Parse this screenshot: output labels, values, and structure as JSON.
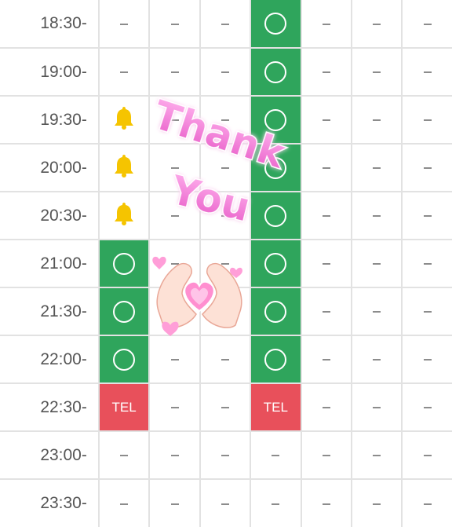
{
  "schedule": {
    "rows": [
      {
        "time": "18:30-",
        "cells": [
          "dash",
          "dash",
          "dash",
          "avail",
          "dash",
          "dash",
          "dash"
        ]
      },
      {
        "time": "19:00-",
        "cells": [
          "dash",
          "dash",
          "dash",
          "avail",
          "dash",
          "dash",
          "dash"
        ]
      },
      {
        "time": "19:30-",
        "cells": [
          "bell",
          "dash",
          "dash",
          "avail",
          "dash",
          "dash",
          "dash"
        ]
      },
      {
        "time": "20:00-",
        "cells": [
          "bell",
          "dash",
          "dash",
          "avail",
          "dash",
          "dash",
          "dash"
        ]
      },
      {
        "time": "20:30-",
        "cells": [
          "bell",
          "dash",
          "dash",
          "avail",
          "dash",
          "dash",
          "dash"
        ]
      },
      {
        "time": "21:00-",
        "cells": [
          "avail",
          "dash",
          "dash",
          "avail",
          "dash",
          "dash",
          "dash"
        ]
      },
      {
        "time": "21:30-",
        "cells": [
          "avail",
          "dash",
          "dash",
          "avail",
          "dash",
          "dash",
          "dash"
        ]
      },
      {
        "time": "22:00-",
        "cells": [
          "avail",
          "dash",
          "dash",
          "avail",
          "dash",
          "dash",
          "dash"
        ]
      },
      {
        "time": "22:30-",
        "cells": [
          "tel",
          "dash",
          "dash",
          "tel",
          "dash",
          "dash",
          "dash"
        ]
      },
      {
        "time": "23:00-",
        "cells": [
          "dash",
          "dash",
          "dash",
          "dash",
          "dash",
          "dash",
          "dash"
        ]
      },
      {
        "time": "23:30-",
        "cells": [
          "dash",
          "dash",
          "dash",
          "dash",
          "dash",
          "dash",
          "dash"
        ]
      }
    ],
    "tel_label": "TEL"
  },
  "stickers": {
    "thanks_line1": "Thank",
    "thanks_line2": "You"
  },
  "icons": {
    "available": "circle-icon",
    "unavailable": "dash-icon",
    "notify": "bell-icon"
  },
  "colors": {
    "available": "#2fa55c",
    "tel": "#e8505b",
    "bell": "#f5c400",
    "sticker_pink": "#f27ad6"
  }
}
